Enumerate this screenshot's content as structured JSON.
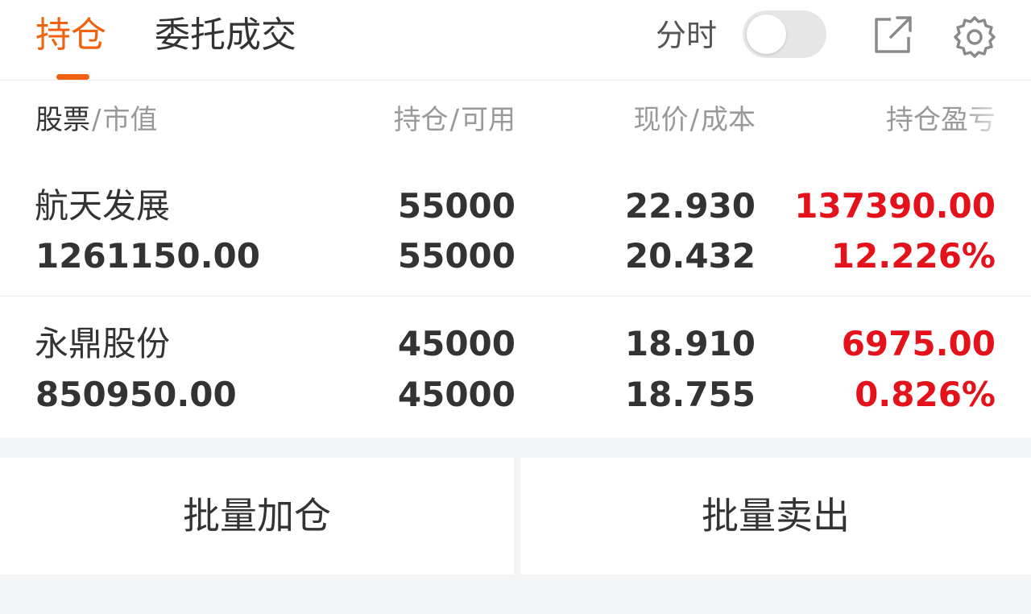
{
  "tabs": {
    "holdings": "持仓",
    "orders": "委托成交"
  },
  "controls": {
    "timeshare_label": "分时",
    "timeshare_enabled": false,
    "share_icon": "external-link-icon",
    "settings_icon": "gear-icon"
  },
  "headers": {
    "stock": "股票",
    "market_value": "市值",
    "position": "持仓",
    "available": "可用",
    "current_price": "现价",
    "cost": "成本",
    "pnl": "持仓盈亏",
    "separator": "/"
  },
  "holdings": [
    {
      "name": "航天发展",
      "market_value": "1261150.00",
      "position": "55000",
      "available": "55000",
      "current_price": "22.930",
      "cost": "20.432",
      "pnl": "137390.00",
      "pnl_pct": "12.226%"
    },
    {
      "name": "永鼎股份",
      "market_value": "850950.00",
      "position": "45000",
      "available": "45000",
      "current_price": "18.910",
      "cost": "18.755",
      "pnl": "6975.00",
      "pnl_pct": "0.826%"
    }
  ],
  "actions": {
    "batch_add": "批量加仓",
    "batch_sell": "批量卖出"
  },
  "colors": {
    "accent": "#f0620f",
    "profit": "#e3121b",
    "text": "#333333",
    "muted": "#999999"
  }
}
